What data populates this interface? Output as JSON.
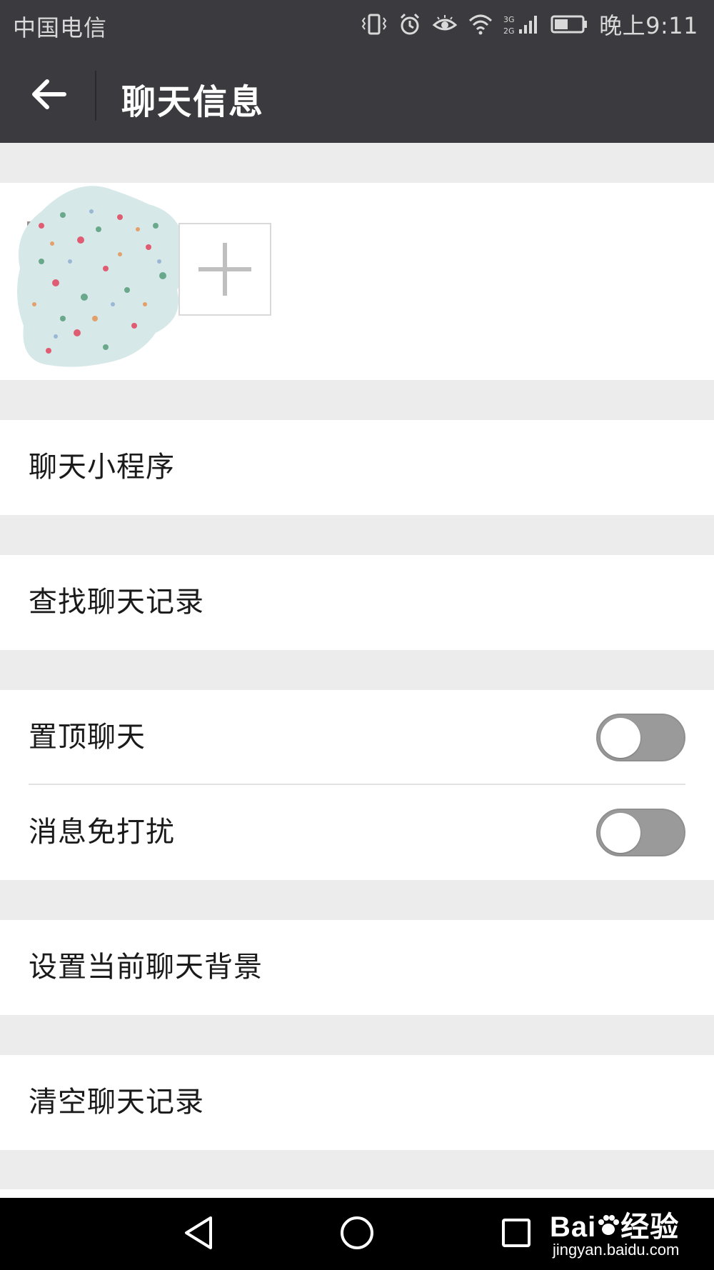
{
  "status_bar": {
    "carrier": "中国电信",
    "network": "3G 2G",
    "time": "晚上9:11"
  },
  "header": {
    "title": "聊天信息",
    "back_icon": "arrow-left-icon"
  },
  "members": {
    "add_icon": "plus-icon"
  },
  "cells": {
    "mini_program": "聊天小程序",
    "search_history": "查找聊天记录",
    "sticky_chat": "置顶聊天",
    "mute": "消息免打扰",
    "set_background": "设置当前聊天背景",
    "clear_history": "清空聊天记录"
  },
  "toggles": {
    "sticky_chat_on": false,
    "mute_on": false
  },
  "nav": {
    "back_icon": "triangle-back-icon",
    "home_icon": "circle-home-icon",
    "recents_icon": "square-recents-icon"
  },
  "watermark": {
    "brand": "Bai",
    "brand_suffix": "经验",
    "url": "jingyan.baidu.com"
  },
  "colors": {
    "header": "#3a3a3f",
    "background": "#ececec",
    "switch_off": "#9a9a9a"
  }
}
